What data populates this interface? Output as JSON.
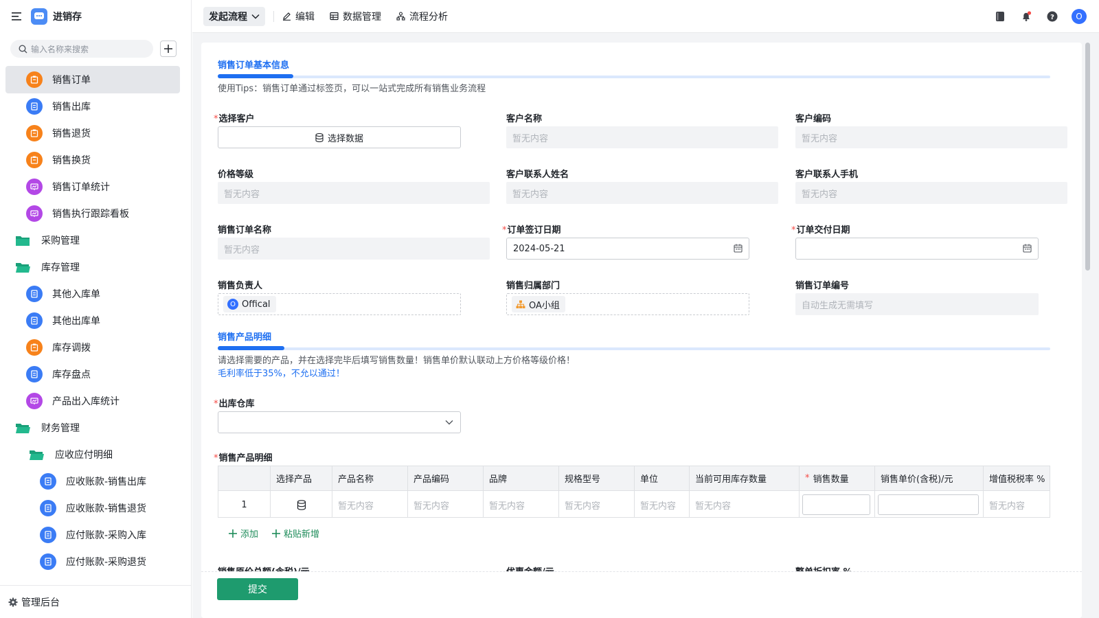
{
  "app": {
    "title": "进销存"
  },
  "sidebar": {
    "search_placeholder": "输入名称来搜索",
    "items": [
      {
        "label": "销售订单",
        "icon": "orange"
      },
      {
        "label": "销售出库",
        "icon": "blue"
      },
      {
        "label": "销售退货",
        "icon": "orange"
      },
      {
        "label": "销售换货",
        "icon": "orange"
      },
      {
        "label": "销售订单统计",
        "icon": "purple"
      },
      {
        "label": "销售执行跟踪看板",
        "icon": "purple"
      },
      {
        "label": "采购管理",
        "icon": "folder"
      },
      {
        "label": "库存管理",
        "icon": "folder"
      },
      {
        "label": "其他入库单",
        "icon": "blue"
      },
      {
        "label": "其他出库单",
        "icon": "blue"
      },
      {
        "label": "库存调拨",
        "icon": "orange"
      },
      {
        "label": "库存盘点",
        "icon": "blue"
      },
      {
        "label": "产品出入库统计",
        "icon": "purple"
      },
      {
        "label": "财务管理",
        "icon": "folder"
      },
      {
        "label": "应收应付明细",
        "icon": "folder"
      },
      {
        "label": "应收账款-销售出库",
        "icon": "blue"
      },
      {
        "label": "应收账款-销售退货",
        "icon": "blue"
      },
      {
        "label": "应付账款-采购入库",
        "icon": "blue"
      },
      {
        "label": "应付账款-采购退货",
        "icon": "blue"
      }
    ],
    "admin_label": "管理后台"
  },
  "topbar": {
    "start_flow": "发起流程",
    "edit": "编辑",
    "data_manage": "数据管理",
    "flow_analysis": "流程分析",
    "avatar": "O"
  },
  "form": {
    "section1": {
      "title": "销售订单基本信息",
      "tip": "使用Tips：销售订单通过标签页，可以一站式完成所有销售业务流程"
    },
    "fields": {
      "select_customer": {
        "label": "选择客户",
        "button": "选择数据"
      },
      "customer_name": {
        "label": "客户名称",
        "value": "暂无内容"
      },
      "customer_code": {
        "label": "客户编码",
        "value": "暂无内容"
      },
      "price_level": {
        "label": "价格等级",
        "value": "暂无内容"
      },
      "contact_name": {
        "label": "客户联系人姓名",
        "value": "暂无内容"
      },
      "contact_phone": {
        "label": "客户联系人手机",
        "value": "暂无内容"
      },
      "order_name": {
        "label": "销售订单名称",
        "value": "暂无内容"
      },
      "sign_date": {
        "label": "订单签订日期",
        "value": "2024-05-21"
      },
      "delivery_date": {
        "label": "订单交付日期",
        "value": ""
      },
      "owner": {
        "label": "销售负责人",
        "tag": "Offical",
        "tag_avatar": "O"
      },
      "dept": {
        "label": "销售归属部门",
        "tag": "OA小组"
      },
      "order_no": {
        "label": "销售订单编号",
        "value": "自动生成无需填写"
      }
    },
    "section2": {
      "title": "销售产品明细",
      "tip": "请选择需要的产品，并在选择完毕后填写销售数量！销售单价默认联动上方价格等级价格！",
      "warning": "毛利率低于35%，不允以通过！"
    },
    "warehouse": {
      "label": "出库仓库"
    },
    "detail": {
      "label": "销售产品明细",
      "columns": [
        "选择产品",
        "产品名称",
        "产品编码",
        "品牌",
        "规格型号",
        "单位",
        "当前可用库存数量",
        "销售数量",
        "销售单价(含税)/元",
        "增值税税率 %"
      ],
      "row": {
        "index": "1",
        "empty": "暂无内容"
      },
      "add": "添加",
      "paste_add": "粘贴新增"
    },
    "bottom_labels": [
      "销售原价总额(含税)/元",
      "优惠金额/元",
      "整单折扣率 %"
    ],
    "submit": "提交"
  }
}
